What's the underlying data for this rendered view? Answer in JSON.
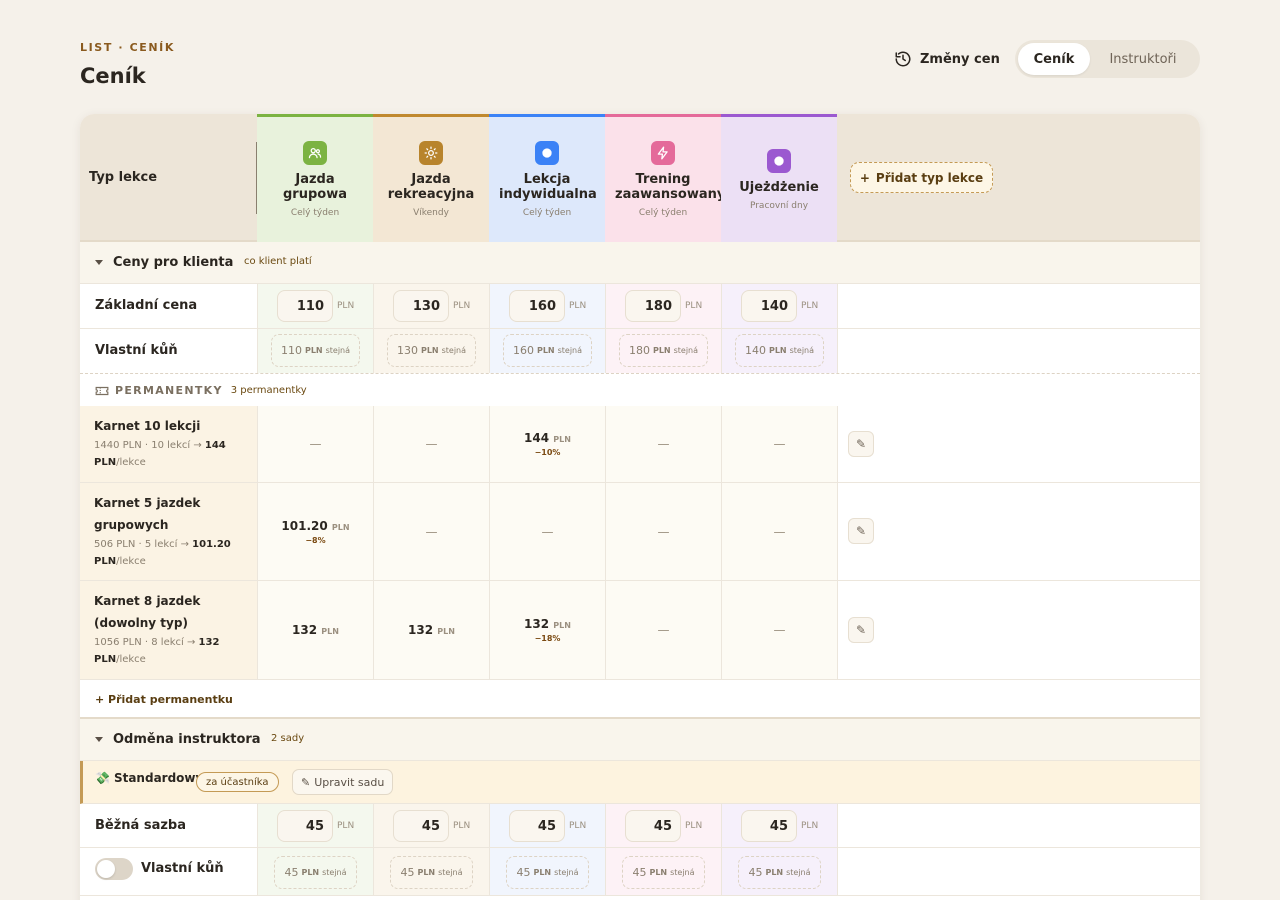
{
  "header": {
    "eyebrow": "LIST · CENÍK",
    "title": "Ceník",
    "history_label": "Změny cen",
    "tabs": [
      {
        "label": "Ceník",
        "active": true
      },
      {
        "label": "Instruktoři",
        "active": false
      }
    ]
  },
  "table": {
    "type_label": "Typ lekce",
    "add_type_label": "Přidat typ lekce",
    "columns": [
      {
        "name": "Jazda grupowa",
        "days": "Celý týden",
        "accent": "#7cb342",
        "bg": "#e8f2dc",
        "cell_bg": "#f4f8ee",
        "icon": "users-icon",
        "icon_bg": "#7cb342"
      },
      {
        "name": "Jazda rekreacyjna",
        "days": "Víkendy",
        "accent": "#c0892f",
        "bg": "#f3e7d4",
        "cell_bg": "#faf5ec",
        "icon": "sun-icon",
        "icon_bg": "#b8842c"
      },
      {
        "name": "Lekcja indywidualna",
        "days": "Celý týden",
        "accent": "#3b82f6",
        "bg": "#dde8fb",
        "cell_bg": "#f1f5fd",
        "icon": "dot-icon",
        "icon_bg": "#3b82f6"
      },
      {
        "name": "Trening zaawansowany",
        "days": "Celý týden",
        "accent": "#e46a9a",
        "bg": "#fbe1ea",
        "cell_bg": "#fdf2f6",
        "icon": "bolt-icon",
        "icon_bg": "#e46a9a"
      },
      {
        "name": "Ujeżdżenie",
        "days": "Pracovní dny",
        "accent": "#9b59d0",
        "bg": "#ece0f5",
        "cell_bg": "#f6f0fb",
        "icon": "dot-icon",
        "icon_bg": "#9b59d0"
      }
    ]
  },
  "client_section": {
    "title": "Ceny pro klienta",
    "badge": "co klient platí",
    "base_label": "Základní cena",
    "base_prices": [
      "110",
      "130",
      "160",
      "180",
      "140"
    ],
    "own_horse_label": "Vlastní kůň",
    "own_horse_prices": [
      "110",
      "130",
      "160",
      "180",
      "140"
    ],
    "unit": "PLN",
    "same_label": "stejná"
  },
  "passes": {
    "title": "PERMANENTKY",
    "badge": "3 permanentky",
    "add_label": "Přidat permanentku",
    "items": [
      {
        "name": "Karnet 10 lekcji",
        "meta_prefix": "1440 PLN · 10 lekcí → ",
        "meta_price": "144",
        "meta_unit": "PLN",
        "meta_suffix": "/lekce",
        "cells": [
          {
            "dash": "—"
          },
          {
            "dash": "—"
          },
          {
            "price": "144",
            "discount": "−10%"
          },
          {
            "dash": "—"
          },
          {
            "dash": "—"
          }
        ]
      },
      {
        "name": "Karnet 5 jazdek grupowych",
        "meta_prefix": "506 PLN · 5 lekcí → ",
        "meta_price": "101.20",
        "meta_unit": "PLN",
        "meta_suffix": "/lekce",
        "cells": [
          {
            "price": "101.20",
            "discount": "−8%"
          },
          {
            "dash": "—"
          },
          {
            "dash": "—"
          },
          {
            "dash": "—"
          },
          {
            "dash": "—"
          }
        ]
      },
      {
        "name": "Karnet 8 jazdek (dowolny typ)",
        "meta_prefix": "1056 PLN · 8 lekcí → ",
        "meta_price": "132",
        "meta_unit": "PLN",
        "meta_suffix": "/lekce",
        "cells": [
          {
            "price": "132"
          },
          {
            "price": "132"
          },
          {
            "price": "132",
            "discount": "−18%"
          },
          {
            "dash": "—"
          },
          {
            "dash": "—"
          }
        ]
      }
    ]
  },
  "instructor_section": {
    "title": "Odměna instruktora",
    "badge": "2 sady",
    "set_name": "Standardowy",
    "set_tag": "za účastníka",
    "set_edit": "Upravit sadu",
    "rate_label": "Běžná sazba",
    "rates": [
      "45",
      "45",
      "45",
      "45",
      "45"
    ],
    "own_horse_label": "Vlastní kůň",
    "own_horse_rates": [
      "45",
      "45",
      "45",
      "45",
      "45"
    ]
  },
  "icons": {
    "history": "history-icon",
    "add": "plus-icon",
    "edit": "pencil-icon",
    "ticket": "ticket-icon",
    "money": "money-icon",
    "caret": "caret-down-icon"
  }
}
